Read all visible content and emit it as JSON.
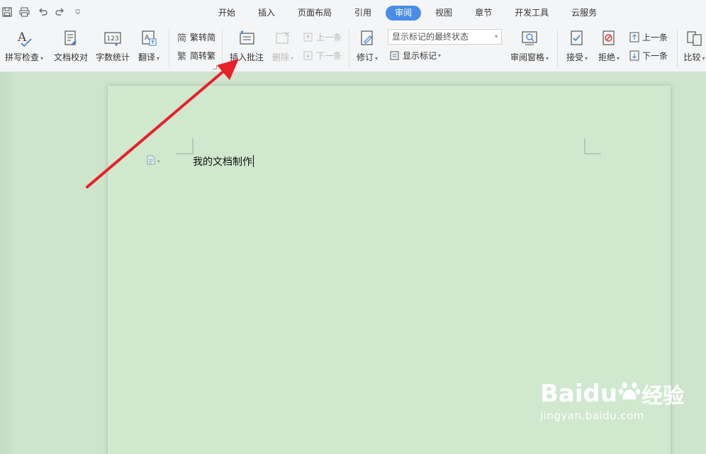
{
  "tabs": [
    "开始",
    "插入",
    "页面布局",
    "引用",
    "审阅",
    "视图",
    "章节",
    "开发工具",
    "云服务"
  ],
  "active_tab": "审阅",
  "ribbon": {
    "spell_check": "拼写检查",
    "doc_proofread": "文档校对",
    "word_count": "字数统计",
    "translate": "翻译",
    "trad_to_simp": "繁转简",
    "simp_to_trad": "简转繁",
    "insert_comment": "插入批注",
    "delete": "删除",
    "prev_comment": "上一条",
    "next_comment": "下一条",
    "revise": "修订",
    "markup_state": "显示标记的最终状态",
    "show_markup": "显示标记",
    "review_pane": "审阅窗格",
    "accept": "接受",
    "reject": "拒绝",
    "prev_change": "上一条",
    "next_change": "下一条",
    "compare": "比较"
  },
  "document": {
    "text": "我的文档制作"
  },
  "watermark": {
    "brand": "Baidu",
    "suffix": "经验",
    "url": "jingyan.baidu.com"
  },
  "colors": {
    "accent": "#4a8ce8",
    "page_bg": "#cfe8ce",
    "arrow": "#e8202a"
  }
}
